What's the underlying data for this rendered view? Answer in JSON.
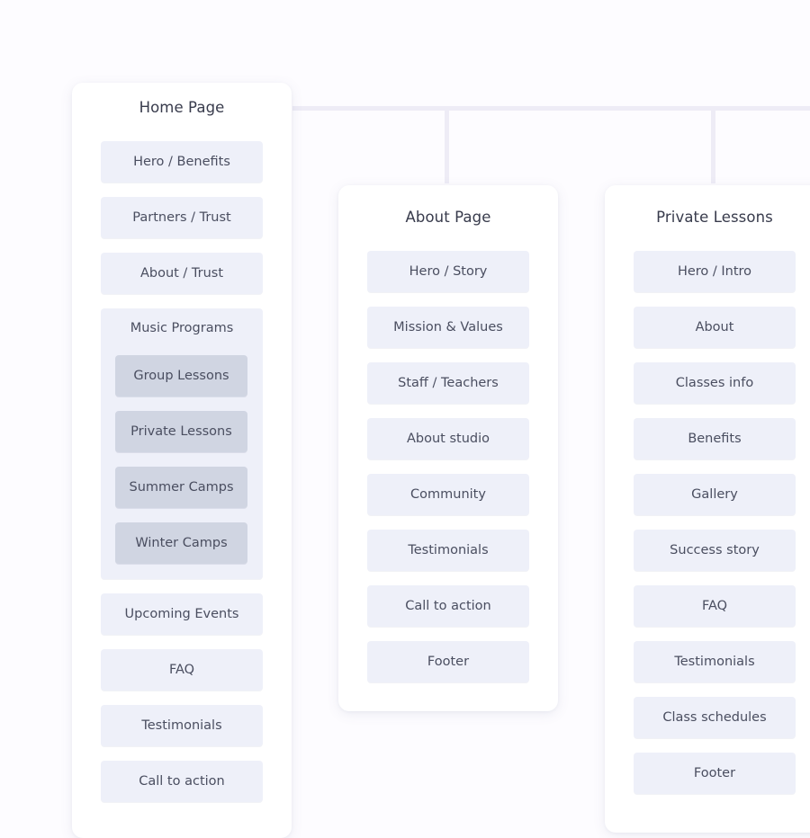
{
  "home": {
    "title": "Home Page",
    "sections_top": [
      "Hero / Benefits",
      "Partners / Trust",
      "About / Trust"
    ],
    "music_programs": {
      "title": "Music Programs",
      "items": [
        "Group Lessons",
        "Private Lessons",
        "Summer Camps",
        "Winter Camps"
      ]
    },
    "sections_bottom": [
      "Upcoming Events",
      "FAQ",
      "Testimonials",
      "Call to action"
    ]
  },
  "about": {
    "title": "About Page",
    "sections": [
      "Hero / Story",
      "Mission & Values",
      "Staff / Teachers",
      "About studio",
      "Community",
      "Testimonials",
      "Call to action",
      "Footer"
    ]
  },
  "private_lessons": {
    "title": "Private Lessons",
    "sections": [
      "Hero / Intro",
      "About",
      "Classes info",
      "Benefits",
      "Gallery",
      "Success story",
      "FAQ",
      "Testimonials",
      "Class schedules",
      "Footer"
    ]
  },
  "colors": {
    "background": "#fdfcff",
    "card": "#ffffff",
    "section": "#eef0f9",
    "subsection": "#d0d5e2",
    "connector": "#eeecf6",
    "text": "#474b5e"
  }
}
